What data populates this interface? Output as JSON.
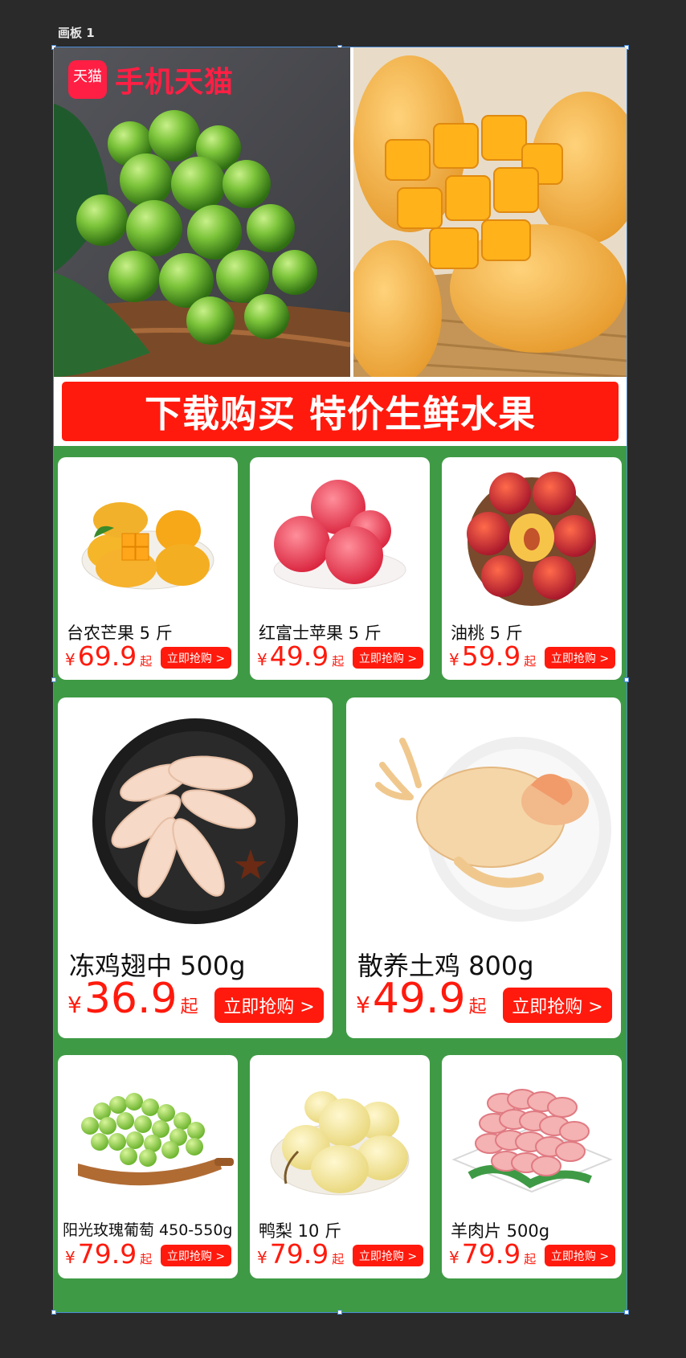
{
  "artboard": {
    "label": "画板 1"
  },
  "hero": {
    "brand_badge": "天猫",
    "brand_text": "手机天猫",
    "banner_text": "下载购买 特价生鲜水果"
  },
  "products_row1": [
    {
      "name": "台农芒果 5 斤",
      "currency": "¥",
      "price": "69.9",
      "suffix": "起",
      "buy": "立即抢购 >",
      "image": "mango-plate"
    },
    {
      "name": "红富士苹果 5 斤",
      "currency": "¥",
      "price": "49.9",
      "suffix": "起",
      "buy": "立即抢购 >",
      "image": "red-apples"
    },
    {
      "name": "油桃 5 斤",
      "currency": "¥",
      "price": "59.9",
      "suffix": "起",
      "buy": "立即抢购 >",
      "image": "nectarines-bowl"
    }
  ],
  "products_row2": [
    {
      "name": "冻鸡翅中 500g",
      "currency": "¥",
      "price": "36.9",
      "suffix": "起",
      "buy": "立即抢购 >",
      "image": "chicken-wings"
    },
    {
      "name": "散养土鸡 800g",
      "currency": "¥",
      "price": "49.9",
      "suffix": "起",
      "buy": "立即抢购 >",
      "image": "whole-chicken"
    }
  ],
  "products_row3": [
    {
      "name": "阳光玫瑰葡萄 450-550g",
      "currency": "¥",
      "price": "79.9",
      "suffix": "起",
      "buy": "立即抢购 >",
      "image": "green-grapes"
    },
    {
      "name": "鸭梨 10 斤",
      "currency": "¥",
      "price": "79.9",
      "suffix": "起",
      "buy": "立即抢购 >",
      "image": "pears-plate"
    },
    {
      "name": "羊肉片 500g",
      "currency": "¥",
      "price": "79.9",
      "suffix": "起",
      "buy": "立即抢购 >",
      "image": "lamb-slices"
    }
  ],
  "colors": {
    "background": "#2a2a2a",
    "canvas_green": "#3f9a45",
    "accent_red": "#ff1a0d",
    "brand_red": "#ff1f44"
  }
}
